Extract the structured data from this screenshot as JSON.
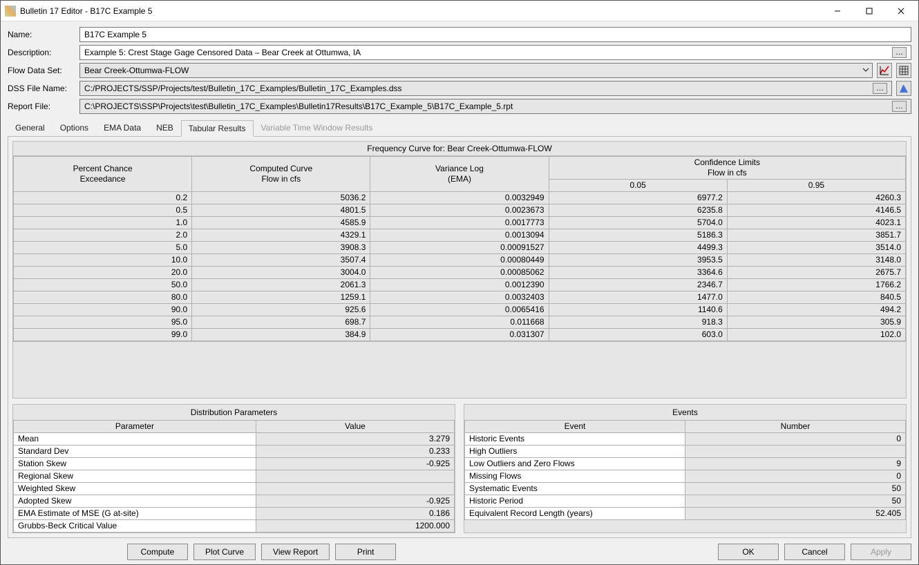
{
  "window": {
    "title": "Bulletin 17 Editor - B17C Example 5"
  },
  "form": {
    "name_lbl": "Name:",
    "name_val": "B17C Example 5",
    "desc_lbl": "Description:",
    "desc_val": "Example 5: Crest Stage Gage Censored Data – Bear Creek at Ottumwa, IA",
    "flowset_lbl": "Flow Data Set:",
    "flowset_val": "Bear Creek-Ottumwa-FLOW",
    "dss_lbl": "DSS File Name:",
    "dss_val": "C:/PROJECTS/SSP/Projects/test/Bulletin_17C_Examples/Bulletin_17C_Examples.dss",
    "report_lbl": "Report File:",
    "report_val": "C:\\PROJECTS\\SSP\\Projects\\test\\Bulletin_17C_Examples\\Bulletin17Results\\B17C_Example_5\\B17C_Example_5.rpt"
  },
  "tabs": {
    "general": "General",
    "options": "Options",
    "ema": "EMA Data",
    "neb": "NEB",
    "tabular": "Tabular Results",
    "vtw": "Variable Time Window Results"
  },
  "freq": {
    "title": "Frequency Curve for: Bear Creek-Ottumwa-FLOW",
    "headers": {
      "pct": "Percent Chance\nExceedance",
      "computed": "Computed Curve\nFlow in cfs",
      "varlog": "Variance Log\n(EMA)",
      "cl_group": "Confidence Limits\nFlow in cfs",
      "cl_05": "0.05",
      "cl_95": "0.95"
    },
    "rows": [
      {
        "pct": "0.2",
        "comp": "5036.2",
        "var": "0.0032949",
        "c05": "6977.2",
        "c95": "4260.3"
      },
      {
        "pct": "0.5",
        "comp": "4801.5",
        "var": "0.0023673",
        "c05": "6235.8",
        "c95": "4146.5"
      },
      {
        "pct": "1.0",
        "comp": "4585.9",
        "var": "0.0017773",
        "c05": "5704.0",
        "c95": "4023.1"
      },
      {
        "pct": "2.0",
        "comp": "4329.1",
        "var": "0.0013094",
        "c05": "5186.3",
        "c95": "3851.7"
      },
      {
        "pct": "5.0",
        "comp": "3908.3",
        "var": "0.00091527",
        "c05": "4499.3",
        "c95": "3514.0"
      },
      {
        "pct": "10.0",
        "comp": "3507.4",
        "var": "0.00080449",
        "c05": "3953.5",
        "c95": "3148.0"
      },
      {
        "pct": "20.0",
        "comp": "3004.0",
        "var": "0.00085062",
        "c05": "3364.6",
        "c95": "2675.7"
      },
      {
        "pct": "50.0",
        "comp": "2061.3",
        "var": "0.0012390",
        "c05": "2346.7",
        "c95": "1766.2"
      },
      {
        "pct": "80.0",
        "comp": "1259.1",
        "var": "0.0032403",
        "c05": "1477.0",
        "c95": "840.5"
      },
      {
        "pct": "90.0",
        "comp": "925.6",
        "var": "0.0065416",
        "c05": "1140.6",
        "c95": "494.2"
      },
      {
        "pct": "95.0",
        "comp": "698.7",
        "var": "0.011668",
        "c05": "918.3",
        "c95": "305.9"
      },
      {
        "pct": "99.0",
        "comp": "384.9",
        "var": "0.031307",
        "c05": "603.0",
        "c95": "102.0"
      }
    ]
  },
  "dist": {
    "title": "Distribution Parameters",
    "col_param": "Parameter",
    "col_value": "Value",
    "rows": [
      {
        "p": "Mean",
        "v": "3.279"
      },
      {
        "p": "Standard Dev",
        "v": "0.233"
      },
      {
        "p": "Station Skew",
        "v": "-0.925"
      },
      {
        "p": "Regional Skew",
        "v": ""
      },
      {
        "p": "Weighted Skew",
        "v": ""
      },
      {
        "p": "Adopted Skew",
        "v": "-0.925"
      },
      {
        "p": "EMA Estimate of MSE (G at-site)",
        "v": "0.186"
      },
      {
        "p": "Grubbs-Beck Critical Value",
        "v": "1200.000"
      }
    ]
  },
  "events": {
    "title": "Events",
    "col_event": "Event",
    "col_number": "Number",
    "rows": [
      {
        "e": "Historic Events",
        "n": "0"
      },
      {
        "e": "High Outliers",
        "n": ""
      },
      {
        "e": "Low Outliers and Zero Flows",
        "n": "9"
      },
      {
        "e": "Missing Flows",
        "n": "0"
      },
      {
        "e": "Systematic Events",
        "n": "50"
      },
      {
        "e": "Historic Period",
        "n": "50"
      },
      {
        "e": "Equivalent Record Length (years)",
        "n": "52.405"
      }
    ]
  },
  "buttons": {
    "compute": "Compute",
    "plot": "Plot Curve",
    "view": "View Report",
    "print": "Print",
    "ok": "OK",
    "cancel": "Cancel",
    "apply": "Apply"
  }
}
